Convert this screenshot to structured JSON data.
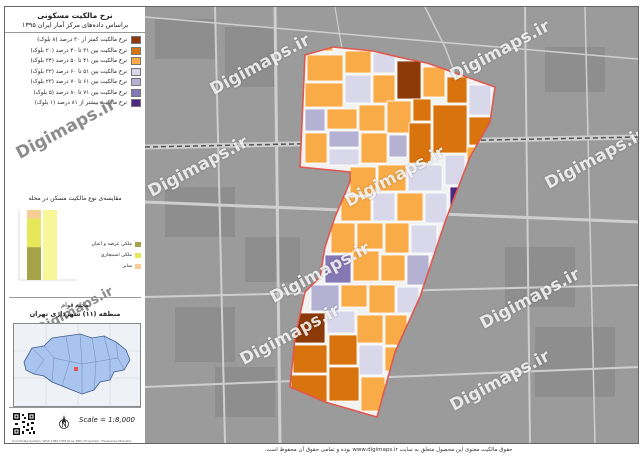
{
  "title": {
    "line1": "نرخ مالکیت مسکونی",
    "line2": "براساس داده‌های مرکز آمار ایران ۱۳۹۵"
  },
  "legend": {
    "items": [
      {
        "label": "نرخ مالکیت کمتر از ۳۰ درصد (۸ بلوک)",
        "color": "#8c3a07"
      },
      {
        "label": "نرخ مالکیت بین ۳۱ تا ۴۰ درصد (۲۰ بلوک)",
        "color": "#d8730e"
      },
      {
        "label": "نرخ مالکیت بین ۴۱ تا ۵۰ درصد (۳۴ بلوک)",
        "color": "#f9ab48"
      },
      {
        "label": "نرخ مالکیت بین ۵۱ تا ۶۰ درصد (۳۲ بلوک)",
        "color": "#d9d8ea"
      },
      {
        "label": "نرخ مالکیت بین ۶۱ تا ۷۰ درصد (۲۳ بلوک)",
        "color": "#b4b1d3"
      },
      {
        "label": "نرخ مالکیت بین ۷۱ تا ۸۰ درصد (۵ بلوک)",
        "color": "#8478b5"
      },
      {
        "label": "نرخ مالکیت بیشتر از ۸۱ درصد (۱ بلوک)",
        "color": "#4d2a80"
      }
    ]
  },
  "chart": {
    "title": "مقایسه‌ی نوع مالکیت مسکن در محله",
    "legend": [
      {
        "label": "ملکی عرصه و اعیان",
        "color": "#a4a34a"
      },
      {
        "label": "ملکی استیجاری",
        "color": "#e6e85a"
      },
      {
        "label": "سایر",
        "color": "#f7cf95"
      }
    ],
    "color_dominant": "#f7f79a"
  },
  "chart_data": {
    "type": "bar",
    "categories": [
      ""
    ],
    "series": [
      {
        "name": "ملکی عرصه و اعیان",
        "values": [
          47
        ]
      },
      {
        "name": "ملکی استیجاری",
        "values": [
          41
        ]
      },
      {
        "name": "سایر",
        "values": [
          12
        ]
      }
    ],
    "ylim": [
      0,
      100
    ],
    "title": "مقایسه‌ی نوع مالکیت مسکن در محله",
    "xlabel": "",
    "ylabel": ""
  },
  "location": {
    "neighborhood": "محله قوام",
    "district": "منطقه (۱۱) شهرداری تهران"
  },
  "scale": "Scale = 1:8,000",
  "watermark": "Digimaps.ir",
  "footer": "حقوق مالکیت معنوی این محصول متعلق به سایت www.digimaps.ir بوده و تمامی حقوق آن محفوظ است.",
  "fineprint": "Coordinate System: WGS 1984 UTM Zone 39N | Projection: Transverse Mercator",
  "colors": {
    "boundary": "#e0584f",
    "road": "#c9c9c9",
    "background": "#9a9a9a"
  }
}
